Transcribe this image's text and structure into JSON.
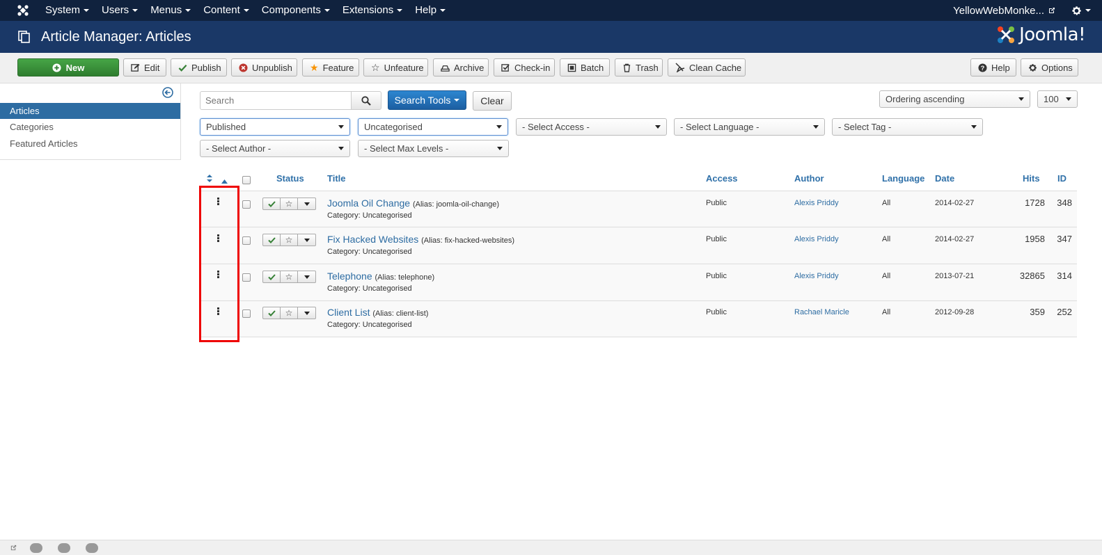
{
  "nav": {
    "menu": [
      "System",
      "Users",
      "Menus",
      "Content",
      "Components",
      "Extensions",
      "Help"
    ],
    "user": "YellowWebMonke..."
  },
  "header": {
    "title": "Article Manager: Articles",
    "brand": "Joomla!"
  },
  "toolbar": {
    "new": "New",
    "edit": "Edit",
    "publish": "Publish",
    "unpublish": "Unpublish",
    "feature": "Feature",
    "unfeature": "Unfeature",
    "archive": "Archive",
    "checkin": "Check-in",
    "batch": "Batch",
    "trash": "Trash",
    "clean_cache": "Clean Cache",
    "help": "Help",
    "options": "Options"
  },
  "sidebar": {
    "items": [
      "Articles",
      "Categories",
      "Featured Articles"
    ]
  },
  "filters": {
    "search_placeholder": "Search",
    "search_tools": "Search Tools",
    "clear": "Clear",
    "ordering": "Ordering ascending",
    "limit": "100",
    "status": "Published",
    "category": "Uncategorised",
    "access": "- Select Access -",
    "language": "- Select Language -",
    "tag": "- Select Tag -",
    "author": "- Select Author -",
    "max_levels": "- Select Max Levels -"
  },
  "table": {
    "headers": {
      "status": "Status",
      "title": "Title",
      "access": "Access",
      "author": "Author",
      "language": "Language",
      "date": "Date",
      "hits": "Hits",
      "id": "ID"
    },
    "rows": [
      {
        "title": "Joomla Oil Change",
        "alias": "(Alias: joomla-oil-change)",
        "category": "Category: Uncategorised",
        "access": "Public",
        "author": "Alexis Priddy",
        "language": "All",
        "date": "2014-02-27",
        "hits": "1728",
        "id": "348"
      },
      {
        "title": "Fix Hacked Websites",
        "alias": "(Alias: fix-hacked-websites)",
        "category": "Category: Uncategorised",
        "access": "Public",
        "author": "Alexis Priddy",
        "language": "All",
        "date": "2014-02-27",
        "hits": "1958",
        "id": "347"
      },
      {
        "title": "Telephone",
        "alias": "(Alias: telephone)",
        "category": "Category: Uncategorised",
        "access": "Public",
        "author": "Alexis Priddy",
        "language": "All",
        "date": "2013-07-21",
        "hits": "32865",
        "id": "314"
      },
      {
        "title": "Client List",
        "alias": "(Alias: client-list)",
        "category": "Category: Uncategorised",
        "access": "Public",
        "author": "Rachael Maricle",
        "language": "All",
        "date": "2012-09-28",
        "hits": "359",
        "id": "252"
      }
    ]
  },
  "colors": {
    "nav_bg": "#10223e",
    "header_bg": "#1a3867",
    "link": "#2d6ca2",
    "new_button": "#46a546",
    "highlight": "#ee0000"
  }
}
